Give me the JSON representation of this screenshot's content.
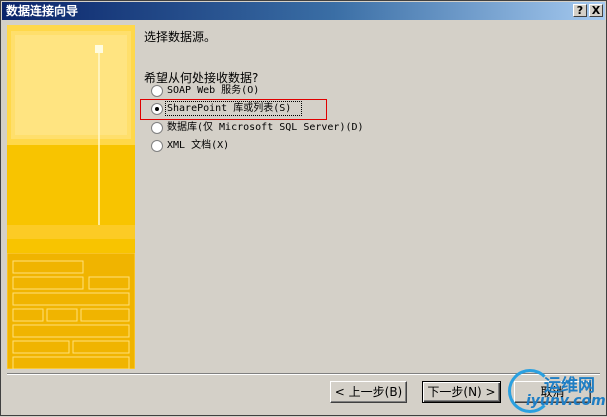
{
  "window": {
    "title": "数据连接向导",
    "help_button": "?",
    "close_button": "X"
  },
  "main": {
    "heading": "选择数据源。",
    "question": "希望从何处接收数据?",
    "options": [
      {
        "label": "SOAP Web 服务(O)",
        "selected": false
      },
      {
        "label": "SharePoint 库或列表(S)",
        "selected": true
      },
      {
        "label": "数据库(仅 Microsoft SQL Server)(D)",
        "selected": false
      },
      {
        "label": "XML 文档(X)",
        "selected": false
      }
    ]
  },
  "buttons": {
    "back": "< 上一步(B)",
    "next": "下一步(N) >",
    "cancel": "取消"
  },
  "watermark": {
    "line1": "运维网",
    "line2": "iyunv.com"
  },
  "colors": {
    "title_bar": "#0a246a",
    "graphic": "#f8c400",
    "highlight": "#e00000",
    "face": "#d4d0c8"
  }
}
